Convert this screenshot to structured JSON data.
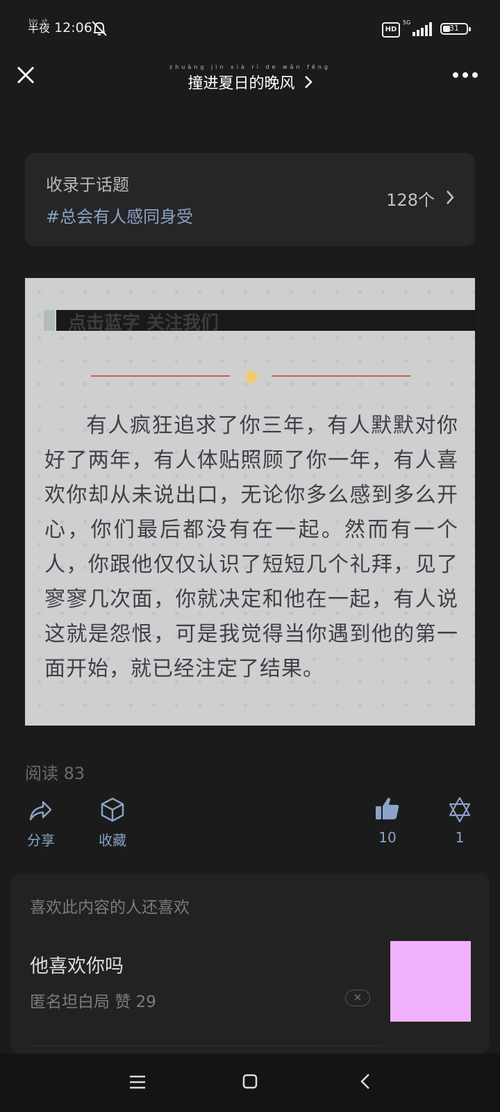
{
  "status_bar": {
    "time_prefix_pinyin": [
      "bàn",
      "yè"
    ],
    "time_prefix": [
      "半",
      "夜"
    ],
    "time": "12:06",
    "hd": "HD",
    "network": "5G",
    "battery": "31"
  },
  "header": {
    "title_pinyin": "zhuàng jìn xià rì de wǎn fēng",
    "title": "撞进夏日的晚风"
  },
  "topic": {
    "label": "收录于话题",
    "tag": "#总会有人感同身受",
    "count": "128个"
  },
  "image": {
    "heading": "点击蓝字 关注我们",
    "paragraph": "有人疯狂追求了你三年，有人默默对你好了两年，有人体贴照顾了你一年，有人喜欢你却从未说出口，无论你多么感到多么开心，你们最后都没有在一起。然而有一个人，你跟他仅仅认识了短短几个礼拜，见了寥寥几次面，你就决定和他在一起，有人说这就是怨恨，可是我觉得当你遇到他的第一面开始，就已经注定了结果。"
  },
  "stats": {
    "read": "阅读 83"
  },
  "actions": {
    "share": "分享",
    "collect": "收藏",
    "likes": "10",
    "comments": "1"
  },
  "recommend": {
    "header": "喜欢此内容的人还喜欢",
    "title": "他喜欢你吗",
    "meta": "匿名坦白局   赞 29",
    "dismiss": "×",
    "thumb_color": "#f0b2fc"
  },
  "colors": {
    "accent": "#8aa3c6",
    "background": "#1b1b1b"
  }
}
